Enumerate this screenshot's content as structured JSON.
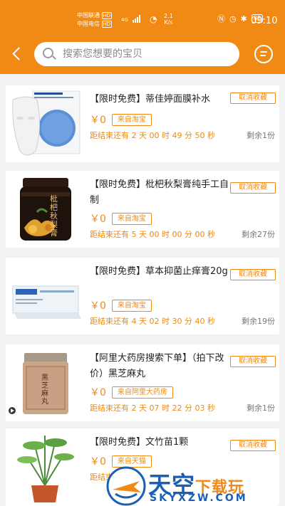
{
  "status_bar": {
    "carrier1": "中国联通",
    "carrier2": "中国电信",
    "hd1": "HD",
    "hd2": "HD",
    "net": "4G",
    "speed": "2.1",
    "speed_unit": "K/s",
    "battery": "88",
    "time": "09:10"
  },
  "header": {
    "search_placeholder": "搜索您想要的宝贝",
    "bg_color": "#f08a14"
  },
  "items": [
    {
      "title": "【限时免费】蒂佳婷面膜补水",
      "price": "￥0",
      "source": "来自淘宝",
      "countdown": "距结束还有 2 天 00 时 49 分 50 秒",
      "remaining": "剩余1份",
      "cancel": "取消收藏"
    },
    {
      "title": "【限时免费】枇杷秋梨膏纯手工自制",
      "price": "￥0",
      "source": "来自淘宝",
      "countdown": "距结束还有 5 天 00 时 00 分 00 秒",
      "remaining": "剩余27份",
      "cancel": "取消收藏",
      "product_label": "枇杷秋梨膏"
    },
    {
      "title": "【限时免费】草本抑菌止痒膏20g",
      "price": "￥0",
      "source": "来自淘宝",
      "countdown": "距结束还有 4 天 02 时 30 分 40 秒",
      "remaining": "剩余19份",
      "cancel": "取消收藏"
    },
    {
      "title": "【阿里大药房搜索下单】（拍下改价）黑芝麻丸",
      "price": "￥0",
      "source": "来自阿里大药房",
      "countdown": "距结束还有 2 天 07 时 22 分 03 秒",
      "remaining": "剩余1份",
      "cancel": "取消收藏",
      "product_label": "黑芝麻丸"
    },
    {
      "title": "【限时免费】文竹苗1颗",
      "price": "￥0",
      "source": "来自天猫",
      "countdown": "距结束还有",
      "remaining": "",
      "cancel": "取消收藏"
    }
  ],
  "watermark": {
    "main": "天空",
    "accent": "下载玩",
    "sub": "SKYXZW.COM"
  }
}
